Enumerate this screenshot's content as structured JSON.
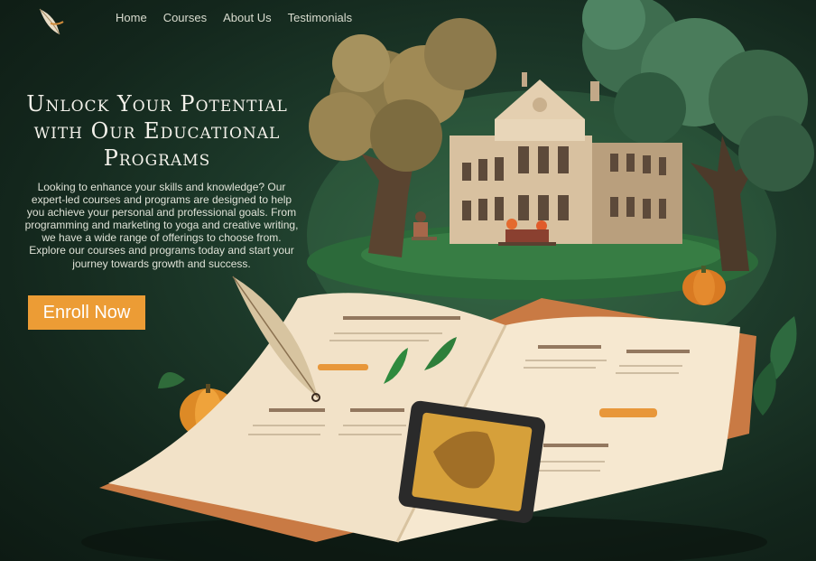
{
  "nav": {
    "items": [
      {
        "label": "Home"
      },
      {
        "label": "Courses"
      },
      {
        "label": "About Us"
      },
      {
        "label": "Testimonials"
      }
    ]
  },
  "hero": {
    "title": "Unlock Your Potential with Our Educational Programs",
    "description": "Looking to enhance your skills and knowledge? Our expert-led courses and programs are designed to help you achieve your personal and professional goals. From programming and marketing to yoga and creative writing, we have a wide range of offerings to choose from. Explore our courses and programs today and start your journey towards growth and success.",
    "cta_label": "Enroll Now"
  },
  "colors": {
    "accent": "#ec9c35",
    "background": "#1d3a2a",
    "text": "#f3f1ea"
  },
  "icons": {
    "logo": "feather-logo-icon"
  }
}
